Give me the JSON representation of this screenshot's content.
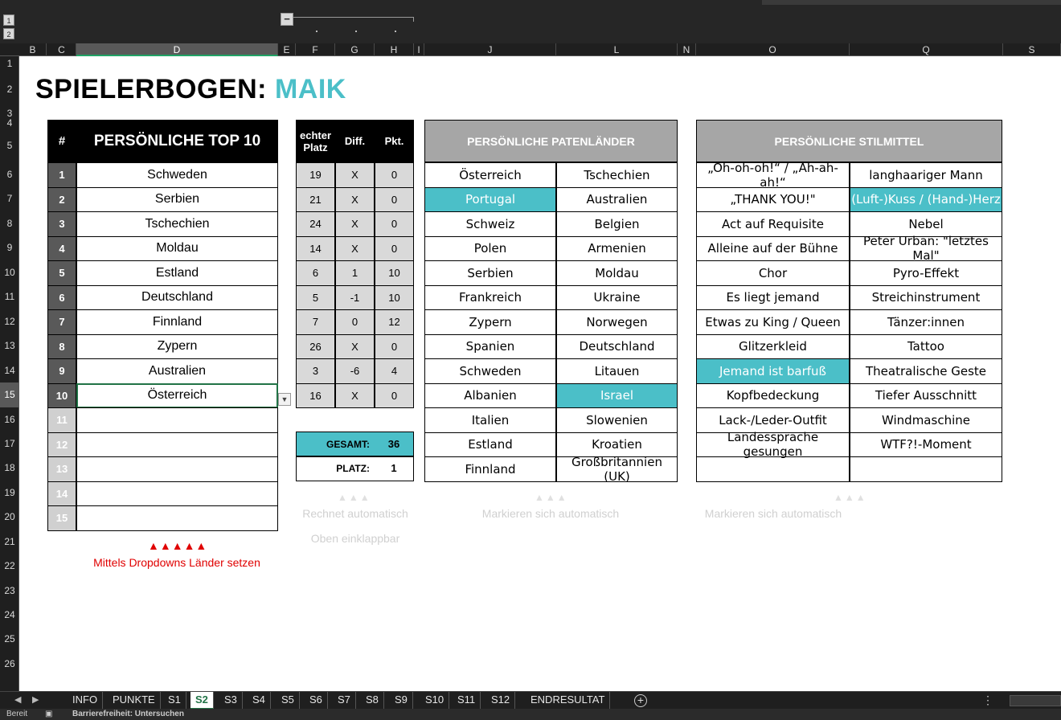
{
  "outline": {
    "level1": "1",
    "level2": "2",
    "collapse": "−"
  },
  "columns": [
    "B",
    "C",
    "D",
    "E",
    "F",
    "G",
    "H",
    "I",
    "J",
    "L",
    "N",
    "O",
    "Q",
    "S"
  ],
  "rows": [
    "1",
    "2",
    "3",
    "4",
    "5",
    "6",
    "7",
    "8",
    "9",
    "10",
    "11",
    "12",
    "13",
    "14",
    "15",
    "16",
    "17",
    "18",
    "19",
    "20",
    "21",
    "22",
    "23",
    "24",
    "25",
    "26"
  ],
  "title": {
    "prefix": "SPIELERBOGEN:",
    "player": "MAIK"
  },
  "top10": {
    "hash": "#",
    "header": "PERSÖNLICHE TOP 10",
    "ranks": [
      "1",
      "2",
      "3",
      "4",
      "5",
      "6",
      "7",
      "8",
      "9",
      "10",
      "11",
      "12",
      "13",
      "14",
      "15"
    ],
    "countries": [
      "Schweden",
      "Serbien",
      "Tschechien",
      "Moldau",
      "Estland",
      "Deutschland",
      "Finnland",
      "Zypern",
      "Australien",
      "Österreich",
      "",
      "",
      "",
      "",
      ""
    ]
  },
  "scores": {
    "header_place": "echter Platz",
    "header_diff": "Diff.",
    "header_points": "Pkt.",
    "rows": [
      {
        "place": "19",
        "diff": "X",
        "pts": "0"
      },
      {
        "place": "21",
        "diff": "X",
        "pts": "0"
      },
      {
        "place": "24",
        "diff": "X",
        "pts": "0"
      },
      {
        "place": "14",
        "diff": "X",
        "pts": "0"
      },
      {
        "place": "6",
        "diff": "1",
        "pts": "10"
      },
      {
        "place": "5",
        "diff": "-1",
        "pts": "10"
      },
      {
        "place": "7",
        "diff": "0",
        "pts": "12"
      },
      {
        "place": "26",
        "diff": "X",
        "pts": "0"
      },
      {
        "place": "3",
        "diff": "-6",
        "pts": "4"
      },
      {
        "place": "16",
        "diff": "X",
        "pts": "0"
      }
    ],
    "total_label": "GESAMT:",
    "total_value": "36",
    "place_label": "PLATZ:",
    "place_value": "1"
  },
  "patenlaender": {
    "header": "PERSÖNLICHE PATENLÄNDER",
    "left": [
      "Österreich",
      "Portugal",
      "Schweiz",
      "Polen",
      "Serbien",
      "Frankreich",
      "Zypern",
      "Spanien",
      "Schweden",
      "Albanien",
      "Italien",
      "Estland",
      "Finnland"
    ],
    "right": [
      "Tschechien",
      "Australien",
      "Belgien",
      "Armenien",
      "Moldau",
      "Ukraine",
      "Norwegen",
      "Deutschland",
      "Litauen",
      "Israel",
      "Slowenien",
      "Kroatien",
      "Großbritannien (UK)"
    ],
    "highlight_left": [
      1
    ],
    "highlight_right": [
      9
    ]
  },
  "stilmittel": {
    "header": "PERSÖNLICHE STILMITTEL",
    "left": [
      "„Oh-oh-oh!“ / „Ah-ah-ah!“",
      "„THANK YOU!\"",
      "Act auf Requisite",
      "Alleine auf der Bühne",
      "Chor",
      "Es liegt jemand",
      "Etwas zu King / Queen",
      "Glitzerkleid",
      "Jemand ist barfuß",
      "Kopfbedeckung",
      "Lack-/Leder-Outfit",
      "Landessprache gesungen",
      ""
    ],
    "right": [
      "langhaariger Mann",
      "(Luft-)Kuss / (Hand-)Herz",
      "Nebel",
      "Peter Urban: \"letztes Mal\"",
      "Pyro-Effekt",
      "Streichinstrument",
      "Tänzer:innen",
      "Tattoo",
      "Theatralische Geste",
      "Tiefer Ausschnitt",
      "Windmaschine",
      "WTF?!-Moment",
      ""
    ],
    "highlight_left": [
      8
    ],
    "highlight_right": [
      1
    ]
  },
  "hints": {
    "arrows_grey": "▲▲▲",
    "scores_1": "Rechnet automatisch",
    "scores_2": "Oben einklappbar",
    "paten": "Markieren sich automatisch",
    "stil": "Markieren sich automatisch",
    "arrows_red": "▲▲▲▲▲",
    "red": "Mittels Dropdowns Länder setzen"
  },
  "tabs": [
    "INFO",
    "PUNKTE",
    "S1",
    "S2",
    "S3",
    "S4",
    "S5",
    "S6",
    "S7",
    "S8",
    "S9",
    "S10",
    "S11",
    "S12",
    "ENDRESULTAT"
  ],
  "active_tab": "S2",
  "status": {
    "ready": "Bereit",
    "accessibility": "Barrierefreiheit: Untersuchen"
  },
  "colors": {
    "teal": "#4bbfc8",
    "dark_grey": "#595959",
    "header_grey": "#a6a6a6",
    "red": "#e00000",
    "excel_green": "#217346"
  }
}
